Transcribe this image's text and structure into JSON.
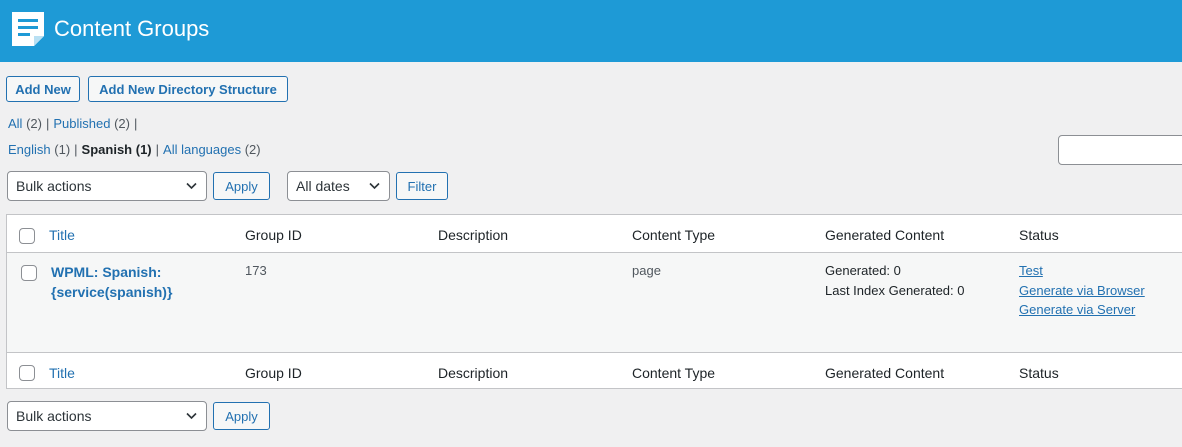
{
  "header": {
    "title": "Content Groups",
    "logo_icon": "content-groups-logo-icon",
    "bg_color": "#1e9ad6"
  },
  "actions": {
    "add_new": "Add New",
    "add_new_directory": "Add New Directory Structure"
  },
  "status_filter": {
    "all_label": "All",
    "all_count": "(2)",
    "published_label": "Published",
    "published_count": "(2)"
  },
  "language_filter": {
    "english_label": "English",
    "english_count": "(1)",
    "spanish_label": "Spanish",
    "spanish_count": "(1)",
    "all_languages_label": "All languages",
    "all_languages_count": "(2)"
  },
  "search": {
    "value": ""
  },
  "tablenav_top": {
    "bulk_actions": "Bulk actions",
    "apply": "Apply",
    "dates": "All dates",
    "filter": "Filter"
  },
  "table": {
    "columns": [
      "Title",
      "Group ID",
      "Description",
      "Content Type",
      "Generated Content",
      "Status"
    ],
    "rows": [
      {
        "title": "WPML: Spanish: {service(spanish)}",
        "group_id": "173",
        "description": "",
        "content_type": "page",
        "generated": "Generated: 0",
        "last_index": "Last Index Generated: 0",
        "status_links": [
          "Test",
          "Generate via Browser",
          "Generate via Server"
        ]
      }
    ]
  },
  "tablenav_bottom": {
    "bulk_actions": "Bulk actions",
    "apply": "Apply"
  }
}
